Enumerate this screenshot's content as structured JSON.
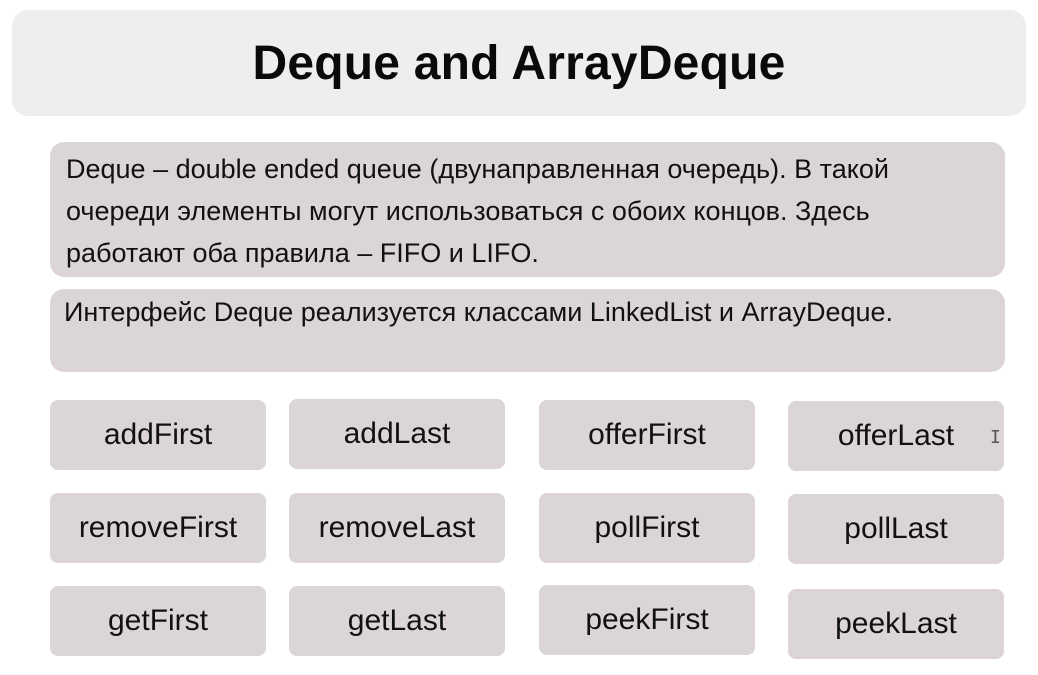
{
  "slide": {
    "title": "Deque and ArrayDeque",
    "paragraph1": "Deque – double ended queue (двунаправленная очередь). В такой очереди элементы могут использоваться с обоих концов. Здесь работают оба правила – FIFO и LIFO.",
    "paragraph2": "Интерфейс Deque реализуется классами LinkedList и ArrayDeque."
  },
  "methods": [
    [
      "addFirst",
      "addLast",
      "offerFirst",
      "offerLast"
    ],
    [
      "removeFirst",
      "removeLast",
      "pollFirst",
      "pollLast"
    ],
    [
      "getFirst",
      "getLast",
      "peekFirst",
      "peekLast"
    ]
  ],
  "colors": {
    "title_background": "#efeded",
    "box_background": "#dcd5d8",
    "text": "#111111"
  },
  "icons": {
    "cursor": "text-cursor-icon"
  }
}
